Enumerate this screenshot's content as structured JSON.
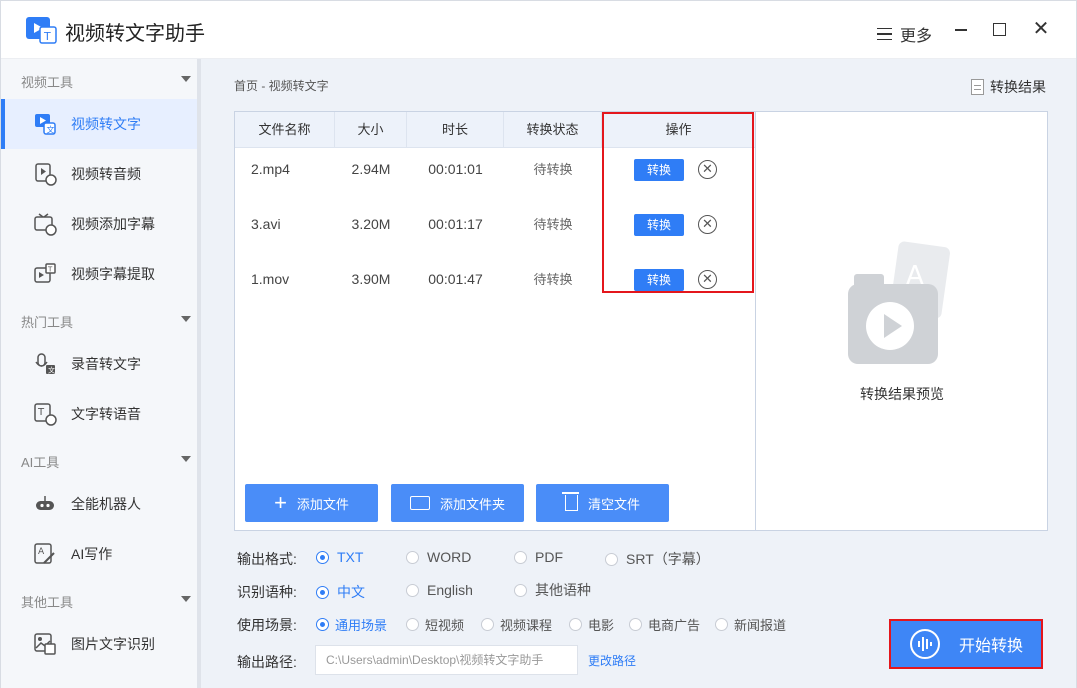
{
  "app": {
    "title": "视频转文字助手"
  },
  "titlebar": {
    "more_label": "更多"
  },
  "sidebar": {
    "sections": [
      {
        "title": "视频工具",
        "items": [
          "视频转文字",
          "视频转音频",
          "视频添加字幕",
          "视频字幕提取"
        ]
      },
      {
        "title": "热门工具",
        "items": [
          "录音转文字",
          "文字转语音"
        ]
      },
      {
        "title": "AI工具",
        "items": [
          "全能机器人",
          "AI写作"
        ]
      },
      {
        "title": "其他工具",
        "items": [
          "图片文字识别"
        ]
      }
    ]
  },
  "breadcrumb": "首页 - 视频转文字",
  "result_link": "转换结果",
  "table": {
    "headers": [
      "文件名称",
      "大小",
      "时长",
      "转换状态",
      "操作"
    ],
    "rows": [
      {
        "name": "2.mp4",
        "size": "2.94M",
        "duration": "00:01:01",
        "status": "待转换",
        "action": "转换"
      },
      {
        "name": "3.avi",
        "size": "3.20M",
        "duration": "00:01:17",
        "status": "待转换",
        "action": "转换"
      },
      {
        "name": "1.mov",
        "size": "3.90M",
        "duration": "00:01:47",
        "status": "待转换",
        "action": "转换"
      }
    ]
  },
  "actions": {
    "add_file": "添加文件",
    "add_folder": "添加文件夹",
    "clear_files": "清空文件"
  },
  "preview": {
    "label": "转换结果预览"
  },
  "options": {
    "format": {
      "label": "输出格式:",
      "choices": [
        "TXT",
        "WORD",
        "PDF",
        "SRT（字幕）"
      ],
      "selected": "TXT"
    },
    "language": {
      "label": "识别语种:",
      "choices": [
        "中文",
        "English",
        "其他语种"
      ],
      "selected": "中文"
    },
    "scene": {
      "label": "使用场景:",
      "choices": [
        "通用场景",
        "短视频",
        "视频课程",
        "电影",
        "电商广告",
        "新闻报道"
      ],
      "selected": "通用场景"
    },
    "path": {
      "label": "输出路径:",
      "value": "C:\\Users\\admin\\Desktop\\视频转文字助手",
      "change": "更改路径"
    }
  },
  "start_button": "开始转换",
  "colors": {
    "accent": "#2f7df6",
    "highlight": "#e4161c"
  }
}
